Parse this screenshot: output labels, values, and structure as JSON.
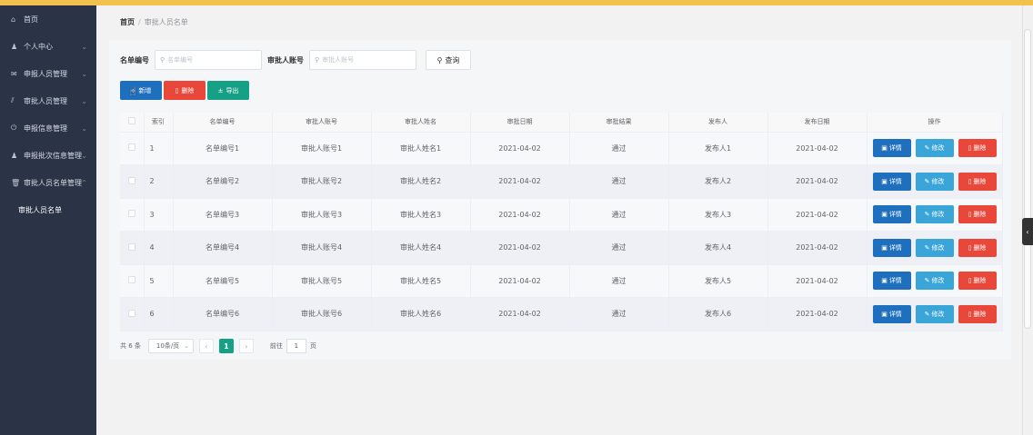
{
  "sidebar": {
    "items": [
      {
        "icon": "home-icon",
        "label": "首页"
      },
      {
        "icon": "user-icon",
        "label": "个人中心"
      },
      {
        "icon": "mail-icon",
        "label": "申报人员管理"
      },
      {
        "icon": "chart-icon",
        "label": "审批人员管理"
      },
      {
        "icon": "power-icon",
        "label": "申报信息管理"
      },
      {
        "icon": "user-icon",
        "label": "申报批次信息管理"
      },
      {
        "icon": "trash-icon",
        "label": "审批人员名单管理"
      }
    ],
    "sub_item": "审批人员名单"
  },
  "breadcrumb": {
    "home": "首页",
    "separator": "/",
    "current": "审批人员名单"
  },
  "search": {
    "field1_label": "名单编号",
    "field1_placeholder": "名单编号",
    "field2_label": "审批人账号",
    "field2_placeholder": "审批人账号",
    "query_button": "查询"
  },
  "actions": {
    "add": "新增",
    "delete": "删除",
    "export": "导出"
  },
  "table": {
    "headers": [
      "索引",
      "名单编号",
      "审批人账号",
      "审批人姓名",
      "审批日期",
      "审批结果",
      "发布人",
      "发布日期",
      "操作"
    ],
    "rows": [
      {
        "idx": "1",
        "list_no": "名单编号1",
        "account": "审批人账号1",
        "name": "审批人姓名1",
        "date": "2021-04-02",
        "result": "通过",
        "publisher": "发布人1",
        "pub_date": "2021-04-02"
      },
      {
        "idx": "2",
        "list_no": "名单编号2",
        "account": "审批人账号2",
        "name": "审批人姓名2",
        "date": "2021-04-02",
        "result": "通过",
        "publisher": "发布人2",
        "pub_date": "2021-04-02"
      },
      {
        "idx": "3",
        "list_no": "名单编号3",
        "account": "审批人账号3",
        "name": "审批人姓名3",
        "date": "2021-04-02",
        "result": "通过",
        "publisher": "发布人3",
        "pub_date": "2021-04-02"
      },
      {
        "idx": "4",
        "list_no": "名单编号4",
        "account": "审批人账号4",
        "name": "审批人姓名4",
        "date": "2021-04-02",
        "result": "通过",
        "publisher": "发布人4",
        "pub_date": "2021-04-02"
      },
      {
        "idx": "5",
        "list_no": "名单编号5",
        "account": "审批人账号5",
        "name": "审批人姓名5",
        "date": "2021-04-02",
        "result": "通过",
        "publisher": "发布人5",
        "pub_date": "2021-04-02"
      },
      {
        "idx": "6",
        "list_no": "名单编号6",
        "account": "审批人账号6",
        "name": "审批人姓名6",
        "date": "2021-04-02",
        "result": "通过",
        "publisher": "发布人6",
        "pub_date": "2021-04-02"
      }
    ],
    "row_actions": {
      "detail": "详情",
      "edit": "修改",
      "delete": "删除"
    }
  },
  "pagination": {
    "total_text": "共 6 条",
    "page_size": "10条/页",
    "current_page": "1",
    "goto_label": "前往",
    "goto_value": "1",
    "page_suffix": "页"
  }
}
